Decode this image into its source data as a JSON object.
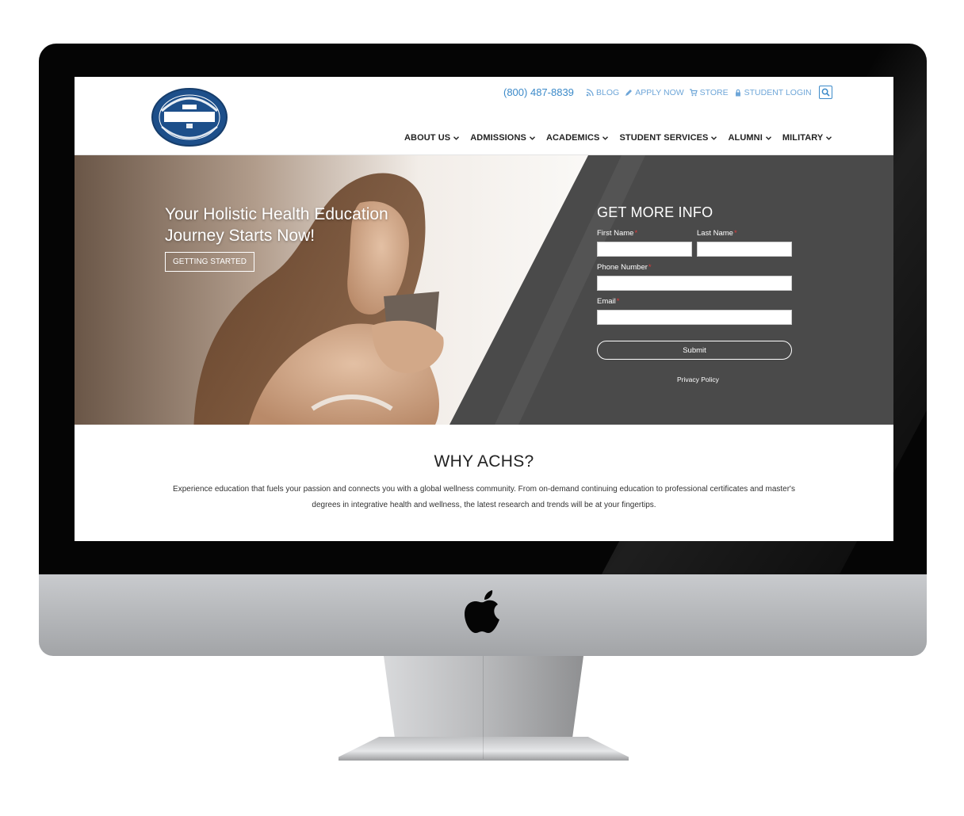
{
  "header": {
    "logo_text": "AMERICAN COLLEGE of HEALTHCARE SCIENCES Est. 1978",
    "phone": "(800) 487-8839",
    "utility_links": [
      {
        "label": "BLOG",
        "icon": "rss-icon"
      },
      {
        "label": "APPLY NOW",
        "icon": "pencil-icon"
      },
      {
        "label": "STORE",
        "icon": "cart-icon"
      },
      {
        "label": "STUDENT LOGIN",
        "icon": "lock-icon"
      }
    ],
    "search_icon": "search-icon",
    "nav": [
      "ABOUT US",
      "ADMISSIONS",
      "ACADEMICS",
      "STUDENT SERVICES",
      "ALUMNI",
      "MILITARY"
    ]
  },
  "hero": {
    "title": "Your Holistic Health Education Journey Starts Now!",
    "cta": "GETTING STARTED"
  },
  "form": {
    "title": "GET MORE INFO",
    "first_name_label": "First Name",
    "last_name_label": "Last Name",
    "phone_label": "Phone Number",
    "email_label": "Email",
    "required_marker": "*",
    "submit": "Submit",
    "privacy": "Privacy Policy"
  },
  "why": {
    "title": "WHY ACHS?",
    "text": "Experience education that fuels your passion and connects you with a global wellness community. From on-demand continuing education to professional certificates and master's degrees in integrative health and wellness, the latest research and trends will be at your fingertips."
  },
  "colors": {
    "accent_blue": "#3c8ac9",
    "form_panel": "#4a4a4a",
    "required_red": "#e03a3a"
  }
}
